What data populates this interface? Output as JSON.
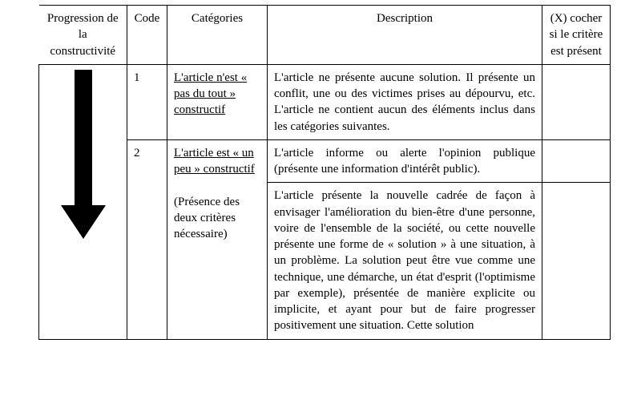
{
  "header": {
    "progression": "Progression de la constructivité",
    "code": "Code",
    "categories": "Catégories",
    "description": "Description",
    "checkbox": "(X) cocher si le critère est présent"
  },
  "rows": {
    "r1": {
      "code": "1",
      "category": "L'article n'est « pas du tout » constructif",
      "description": "L'article ne présente aucune solution. Il présente un conflit, une ou des victimes prises au dépourvu, etc. L'article ne contient aucun des éléments inclus dans les catégories suivantes.",
      "check": ""
    },
    "r2": {
      "code": "2",
      "category_line": "L'article est « un peu » constructif",
      "category_note": "(Présence des deux critères nécessaire)",
      "d1": "L'article informe ou alerte l'opinion publique (présente une information d'intérêt public).",
      "d2": "L'article présente la nouvelle cadrée de façon à envisager l'amélioration du bien-être d'une personne, voire de l'ensemble de la société, ou cette nouvelle présente une forme de « solution » à une situation, à un problème. La solution peut être vue comme une technique, une démarche, un état d'esprit (l'optimisme par exemple), présentée de manière explicite ou implicite, et ayant pour but de faire progresser positivement une situation. Cette solution",
      "check1": "",
      "check2": ""
    }
  }
}
